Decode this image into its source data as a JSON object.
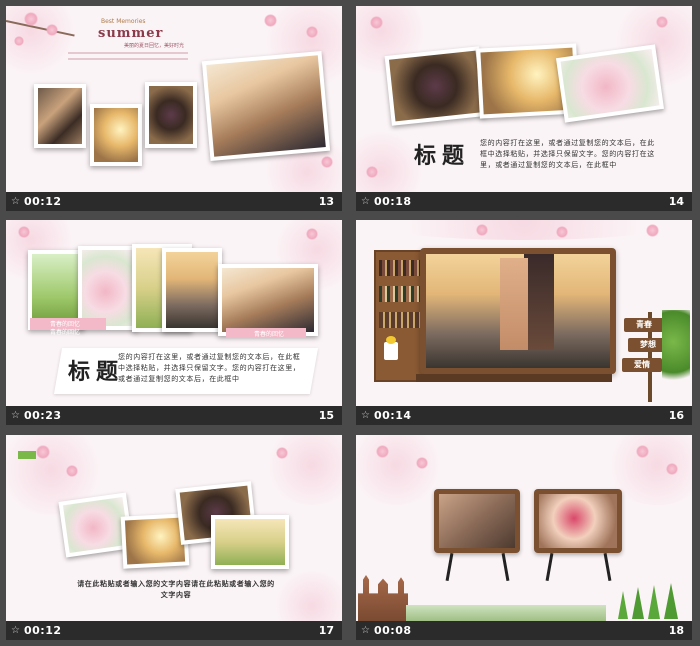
{
  "slides": [
    {
      "time": "00:12",
      "number": "13",
      "small_text": "Best Memories",
      "heading": "summer",
      "caption": "美丽的夏日回忆，美好时光"
    },
    {
      "time": "00:18",
      "number": "14",
      "title": "标题",
      "body": "您的内容打在这里，或者通过复制您的文本后，在此框中选择粘贴，并选择只保留文字。您的内容打在这里，或者通过复制您的文本后，在此框中"
    },
    {
      "time": "00:23",
      "number": "15",
      "title": "标题",
      "caption1": "青春的回忆",
      "caption2": "青春的回忆",
      "caption3": "青春的回忆",
      "body": "您的内容打在这里，或者通过复制您的文本后，在此框中选择粘贴，并选择只保留文字。您的内容打在这里，或者通过复制您的文本后，在此框中"
    },
    {
      "time": "00:14",
      "number": "16",
      "sign1": "青春",
      "sign2": "梦想",
      "sign3": "爱情"
    },
    {
      "time": "00:12",
      "number": "17",
      "body": "请在此粘贴或者输入您的文字内容请在此粘贴或者输入您的文字内容"
    },
    {
      "time": "00:08",
      "number": "18"
    }
  ],
  "icons": {
    "timer": "star-icon"
  },
  "colors": {
    "background": "#4a4a4a",
    "slide": "#fbf4f6",
    "bar": "#2b2b2b",
    "accent_pink": "#f0a9bf"
  }
}
